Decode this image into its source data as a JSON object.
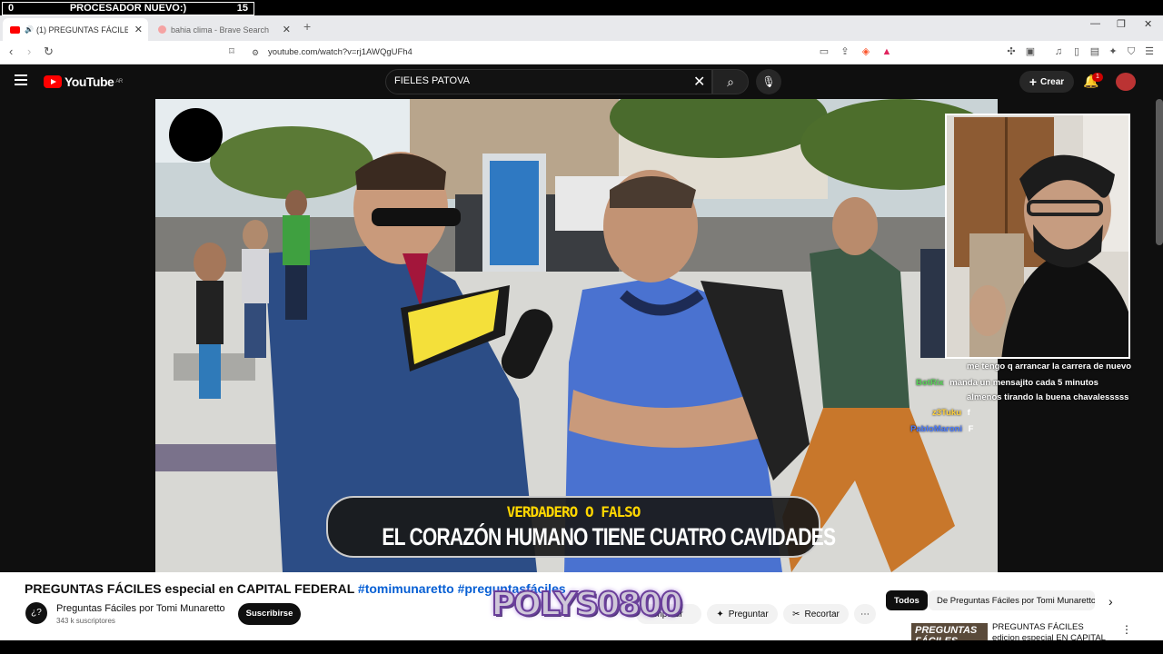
{
  "obs_overlay": {
    "left": "0",
    "center": "PROCESADOR NUEVO:)",
    "right": "15"
  },
  "tabs": [
    {
      "label": "(1) PREGUNTAS FÁCILES espe",
      "active": true
    },
    {
      "label": "bahia clima - Brave Search",
      "active": false
    }
  ],
  "address_bar": {
    "url": "youtube.com/watch?v=rj1AWQgUFh4"
  },
  "youtube": {
    "logo": "YouTube",
    "logo_region": "AR",
    "search_value": "FIELES PATOVA",
    "create_label": "Crear",
    "notification_count": "1"
  },
  "video": {
    "caption_small": "VERDADERO O FALSO",
    "caption_large": "EL CORAZÓN HUMANO TIENE CUATRO CAVIDADES"
  },
  "stream_chat": [
    {
      "user": "",
      "text": "me tengo q arrancar la carrera de nuevo",
      "color": "#ffffff"
    },
    {
      "user": "BotRix",
      "text": "manda un mensajito cada 5 minutos",
      "color": "#5bd35b"
    },
    {
      "user": "",
      "text": "almenos tirando la buena chavalesssss",
      "color": "#ffffff"
    },
    {
      "user": "z3Tuku",
      "text": "f",
      "color": "#ffd23f"
    },
    {
      "user": "PabloMaroni",
      "text": "F",
      "color": "#4a7bff"
    }
  ],
  "video_info": {
    "title_plain": "PREGUNTAS FÁCILES especial en CAPITAL FEDERAL ",
    "hashtags": "#tomimunaretto #preguntasfáciles",
    "channel_name": "Preguntas Fáciles por Tomi Munaretto",
    "subscribers": "343 k suscriptores",
    "subscribe_label": "Suscribirse",
    "share_label": "mpartir",
    "ask_label": "Preguntar",
    "clip_label": "Recortar",
    "overlay_logo": "POLYS0800"
  },
  "recommendations": {
    "chip_all": "Todos",
    "chip_channel": "De Preguntas Fáciles por Tomi Munaretto",
    "first_title": "PREGUNTAS FÁCILES edicion especial EN CAPITAL",
    "first_thumb_text": "PREGUNTAS FÁCILES"
  },
  "colors": {
    "youtube_red": "#ff0000",
    "link_blue": "#065fd4",
    "caption_yellow": "#ffd600"
  }
}
